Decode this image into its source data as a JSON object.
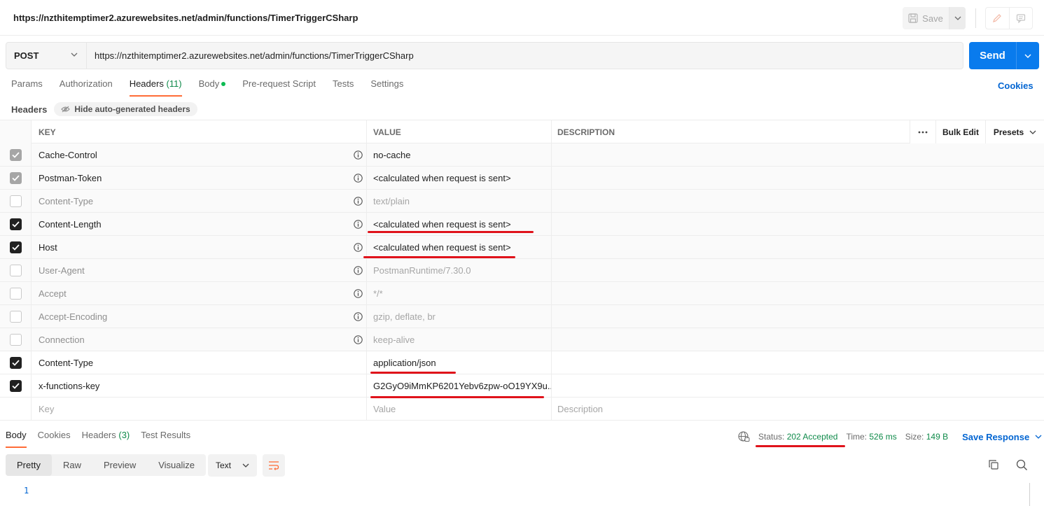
{
  "title": {
    "url": "https://nzthitemptimer2.azurewebsites.net/admin/functions/TimerTriggerCSharp",
    "save_label": "Save"
  },
  "request": {
    "method": "POST",
    "url": "https://nzthitemptimer2.azurewebsites.net/admin/functions/TimerTriggerCSharp",
    "send_label": "Send"
  },
  "tabs": {
    "params": "Params",
    "authorization": "Authorization",
    "headers": "Headers",
    "headers_count": "(11)",
    "body": "Body",
    "prerequest": "Pre-request Script",
    "tests": "Tests",
    "settings": "Settings",
    "cookies": "Cookies"
  },
  "headers_bar": {
    "label": "Headers",
    "hide_auto": "Hide auto-generated headers"
  },
  "table": {
    "columns": {
      "key": "KEY",
      "value": "VALUE",
      "description": "DESCRIPTION"
    },
    "more": "ooo",
    "bulk_edit": "Bulk Edit",
    "presets": "Presets",
    "rows": [
      {
        "key": "Cache-Control",
        "value": "no-cache",
        "state": "auto-on"
      },
      {
        "key": "Postman-Token",
        "value": "<calculated when request is sent>",
        "state": "auto-on"
      },
      {
        "key": "Content-Type",
        "value": "text/plain",
        "state": "auto-off"
      },
      {
        "key": "Content-Length",
        "value": "<calculated when request is sent>",
        "state": "auto-checked"
      },
      {
        "key": "Host",
        "value": "<calculated when request is sent>",
        "state": "auto-checked"
      },
      {
        "key": "User-Agent",
        "value": "PostmanRuntime/7.30.0",
        "state": "auto-off"
      },
      {
        "key": "Accept",
        "value": "*/*",
        "state": "auto-off"
      },
      {
        "key": "Accept-Encoding",
        "value": "gzip, deflate, br",
        "state": "auto-off"
      },
      {
        "key": "Connection",
        "value": "keep-alive",
        "state": "auto-off"
      },
      {
        "key": "Content-Type",
        "value": "application/json",
        "state": "user-on"
      },
      {
        "key": "x-functions-key",
        "value": "G2GyO9iMmKP6201Yebv6zpw-oO19YX9u...",
        "state": "user-on"
      }
    ],
    "placeholder": {
      "key": "Key",
      "value": "Value",
      "description": "Description"
    }
  },
  "response": {
    "tabs": {
      "body": "Body",
      "cookies": "Cookies",
      "headers": "Headers",
      "headers_count": "(3)",
      "test_results": "Test Results"
    },
    "status_label": "Status:",
    "status_value": "202 Accepted",
    "time_label": "Time:",
    "time_value": "526 ms",
    "size_label": "Size:",
    "size_value": "149 B",
    "save_response": "Save Response",
    "formats": {
      "pretty": "Pretty",
      "raw": "Raw",
      "preview": "Preview",
      "visualize": "Visualize"
    },
    "text_type": "Text",
    "line_number": "1"
  },
  "colors": {
    "accent": "#ff6c37",
    "send": "#097bed",
    "annotation": "#e0131b",
    "status_ok": "#0f8a4a"
  }
}
